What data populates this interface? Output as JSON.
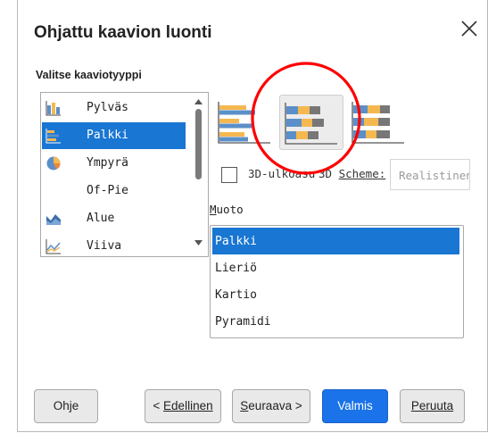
{
  "dialog": {
    "title": "Ohjattu kaavion luonti"
  },
  "chart_type_section": {
    "label": "Valitse kaaviotyyppi"
  },
  "chart_types": [
    {
      "label": "Pylväs",
      "icon": "column-chart-icon",
      "selected": false
    },
    {
      "label": "Palkki",
      "icon": "bar-chart-icon",
      "selected": true
    },
    {
      "label": "Ympyrä",
      "icon": "pie-chart-icon",
      "selected": false
    },
    {
      "label": "Of-Pie",
      "icon": "",
      "selected": false
    },
    {
      "label": "Alue",
      "icon": "area-chart-icon",
      "selected": false
    },
    {
      "label": "Viiva",
      "icon": "line-chart-icon",
      "selected": false
    }
  ],
  "variants": [
    {
      "name": "normal",
      "selected": false
    },
    {
      "name": "stacked",
      "selected": true
    },
    {
      "name": "percent-stacked",
      "selected": false
    }
  ],
  "options": {
    "look3d_label_a": "3D-ulkoasu",
    "look3d_label_b": "3D ",
    "scheme_label": "Scheme:",
    "scheme_value": "Realistinen",
    "checked": false
  },
  "shape": {
    "label": "Muoto",
    "items": [
      {
        "label": "Palkki",
        "selected": true
      },
      {
        "label": "Lieriö",
        "selected": false
      },
      {
        "label": "Kartio",
        "selected": false
      },
      {
        "label": "Pyramidi",
        "selected": false
      }
    ]
  },
  "buttons": {
    "help": "Ohje",
    "prev": "Edellinen",
    "next": "euraava >",
    "finish": "Valmis",
    "cancel": "Peruuta"
  },
  "colors": {
    "selection": "#1976d2",
    "primary_button": "#1a73e8",
    "annotation": "#ff0000",
    "bar_blue": "#5b8fc9",
    "bar_orange": "#f5b850"
  }
}
